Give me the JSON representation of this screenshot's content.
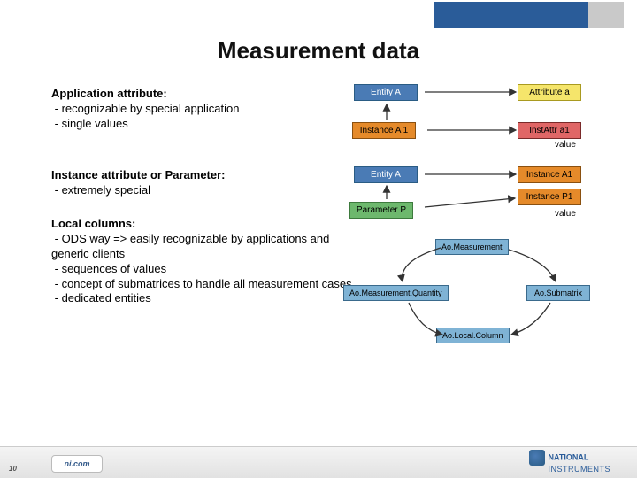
{
  "title": "Measurement data",
  "sections": {
    "app_attr": {
      "heading": "Application attribute:",
      "bullets": [
        "- recognizable by special application",
        "- single values"
      ]
    },
    "inst_attr": {
      "heading": "Instance attribute or Parameter:",
      "bullets": [
        "- extremely special"
      ]
    },
    "local_cols": {
      "heading": "Local columns:",
      "bullets": [
        "- ODS way => easily recognizable by applications and generic clients",
        "- sequences of values",
        "- concept of submatrices to handle all measurement cases",
        "- dedicated entities"
      ]
    }
  },
  "diagram1": {
    "entity": "Entity A",
    "instance": "Instance A 1",
    "attribute": "Attribute a",
    "instattr": "InstAttr a1",
    "value_label": "value"
  },
  "diagram2": {
    "entity": "Entity A",
    "parameter": "Parameter P",
    "instanceA": "Instance A1",
    "instanceP": "Instance P1",
    "value_label": "value"
  },
  "diagram3": {
    "measurement": "Ao.Measurement",
    "quantity": "Ao.Measurement.Quantity",
    "submatrix": "Ao.Submatrix",
    "localcolumn": "Ao.Local.Column"
  },
  "footer": {
    "page": "10",
    "nicom": "ni.com",
    "brand_top": "NATIONAL",
    "brand_bottom": "INSTRUMENTS"
  }
}
